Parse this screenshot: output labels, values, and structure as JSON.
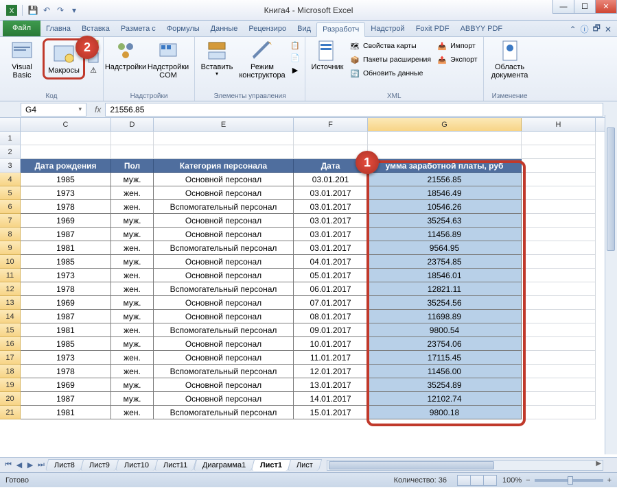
{
  "app": {
    "title": "Книга4 - Microsoft Excel"
  },
  "tabs": {
    "file": "Файл",
    "items": [
      "Главна",
      "Вставка",
      "Размета с",
      "Формулы",
      "Данные",
      "Рецензиро",
      "Вид",
      "Разработч",
      "Надстрой",
      "Foxit PDF",
      "ABBYY PDF"
    ],
    "active_index": 7
  },
  "ribbon": {
    "groups": [
      {
        "label": "Код",
        "buttons": [
          "Visual Basic",
          "Макросы"
        ]
      },
      {
        "label": "Надстройки",
        "buttons": [
          "Надстройки",
          "Надстройки COM"
        ]
      },
      {
        "label": "Элементы управления",
        "buttons": [
          "Вставить",
          "Режим конструктора"
        ]
      },
      {
        "label": "XML",
        "source": "Источник",
        "items": [
          "Свойства карты",
          "Пакеты расширения",
          "Обновить данные",
          "Импорт",
          "Экспорт"
        ]
      },
      {
        "label": "Изменение",
        "buttons": [
          "Область документа"
        ]
      }
    ]
  },
  "formula_bar": {
    "name_box": "G4",
    "fx": "fx",
    "value": "21556.85"
  },
  "columns": [
    "C",
    "D",
    "E",
    "F",
    "G",
    "H"
  ],
  "selected_col": "G",
  "header_row_num": 3,
  "headers": [
    "Дата рождения",
    "Пол",
    "Категория персонала",
    "Дата",
    "умма заработной платы, руб"
  ],
  "row_start": 1,
  "data_rows": [
    {
      "n": 4,
      "c": "1985",
      "d": "муж.",
      "e": "Основной персонал",
      "f": "03.01.201",
      "g": "21556.85"
    },
    {
      "n": 5,
      "c": "1973",
      "d": "жен.",
      "e": "Основной персонал",
      "f": "03.01.2017",
      "g": "18546.49"
    },
    {
      "n": 6,
      "c": "1978",
      "d": "жен.",
      "e": "Вспомогательный персонал",
      "f": "03.01.2017",
      "g": "10546.26"
    },
    {
      "n": 7,
      "c": "1969",
      "d": "муж.",
      "e": "Основной персонал",
      "f": "03.01.2017",
      "g": "35254.63"
    },
    {
      "n": 8,
      "c": "1987",
      "d": "муж.",
      "e": "Основной персонал",
      "f": "03.01.2017",
      "g": "11456.89"
    },
    {
      "n": 9,
      "c": "1981",
      "d": "жен.",
      "e": "Вспомогательный персонал",
      "f": "03.01.2017",
      "g": "9564.95"
    },
    {
      "n": 10,
      "c": "1985",
      "d": "муж.",
      "e": "Основной персонал",
      "f": "04.01.2017",
      "g": "23754.85"
    },
    {
      "n": 11,
      "c": "1973",
      "d": "жен.",
      "e": "Основной персонал",
      "f": "05.01.2017",
      "g": "18546.01"
    },
    {
      "n": 12,
      "c": "1978",
      "d": "жен.",
      "e": "Вспомогательный персонал",
      "f": "06.01.2017",
      "g": "12821.11"
    },
    {
      "n": 13,
      "c": "1969",
      "d": "муж.",
      "e": "Основной персонал",
      "f": "07.01.2017",
      "g": "35254.56"
    },
    {
      "n": 14,
      "c": "1987",
      "d": "муж.",
      "e": "Основной персонал",
      "f": "08.01.2017",
      "g": "11698.89"
    },
    {
      "n": 15,
      "c": "1981",
      "d": "жен.",
      "e": "Вспомогательный персонал",
      "f": "09.01.2017",
      "g": "9800.54"
    },
    {
      "n": 16,
      "c": "1985",
      "d": "муж.",
      "e": "Основной персонал",
      "f": "10.01.2017",
      "g": "23754.06"
    },
    {
      "n": 17,
      "c": "1973",
      "d": "жен.",
      "e": "Основной персонал",
      "f": "11.01.2017",
      "g": "17115.45"
    },
    {
      "n": 18,
      "c": "1978",
      "d": "жен.",
      "e": "Вспомогательный персонал",
      "f": "12.01.2017",
      "g": "11456.00"
    },
    {
      "n": 19,
      "c": "1969",
      "d": "муж.",
      "e": "Основной персонал",
      "f": "13.01.2017",
      "g": "35254.89"
    },
    {
      "n": 20,
      "c": "1987",
      "d": "муж.",
      "e": "Основной персонал",
      "f": "14.01.2017",
      "g": "12102.74"
    },
    {
      "n": 21,
      "c": "1981",
      "d": "жен.",
      "e": "Вспомогательный персонал",
      "f": "15.01.2017",
      "g": "9800.18"
    }
  ],
  "sheets": [
    "Лист8",
    "Лист9",
    "Лист10",
    "Лист11",
    "Диаграмма1",
    "Лист1",
    "Лист"
  ],
  "active_sheet": 5,
  "status": {
    "ready": "Готово",
    "count_label": "Количество: 36",
    "zoom": "100%"
  },
  "badges": {
    "1": "1",
    "2": "2"
  }
}
